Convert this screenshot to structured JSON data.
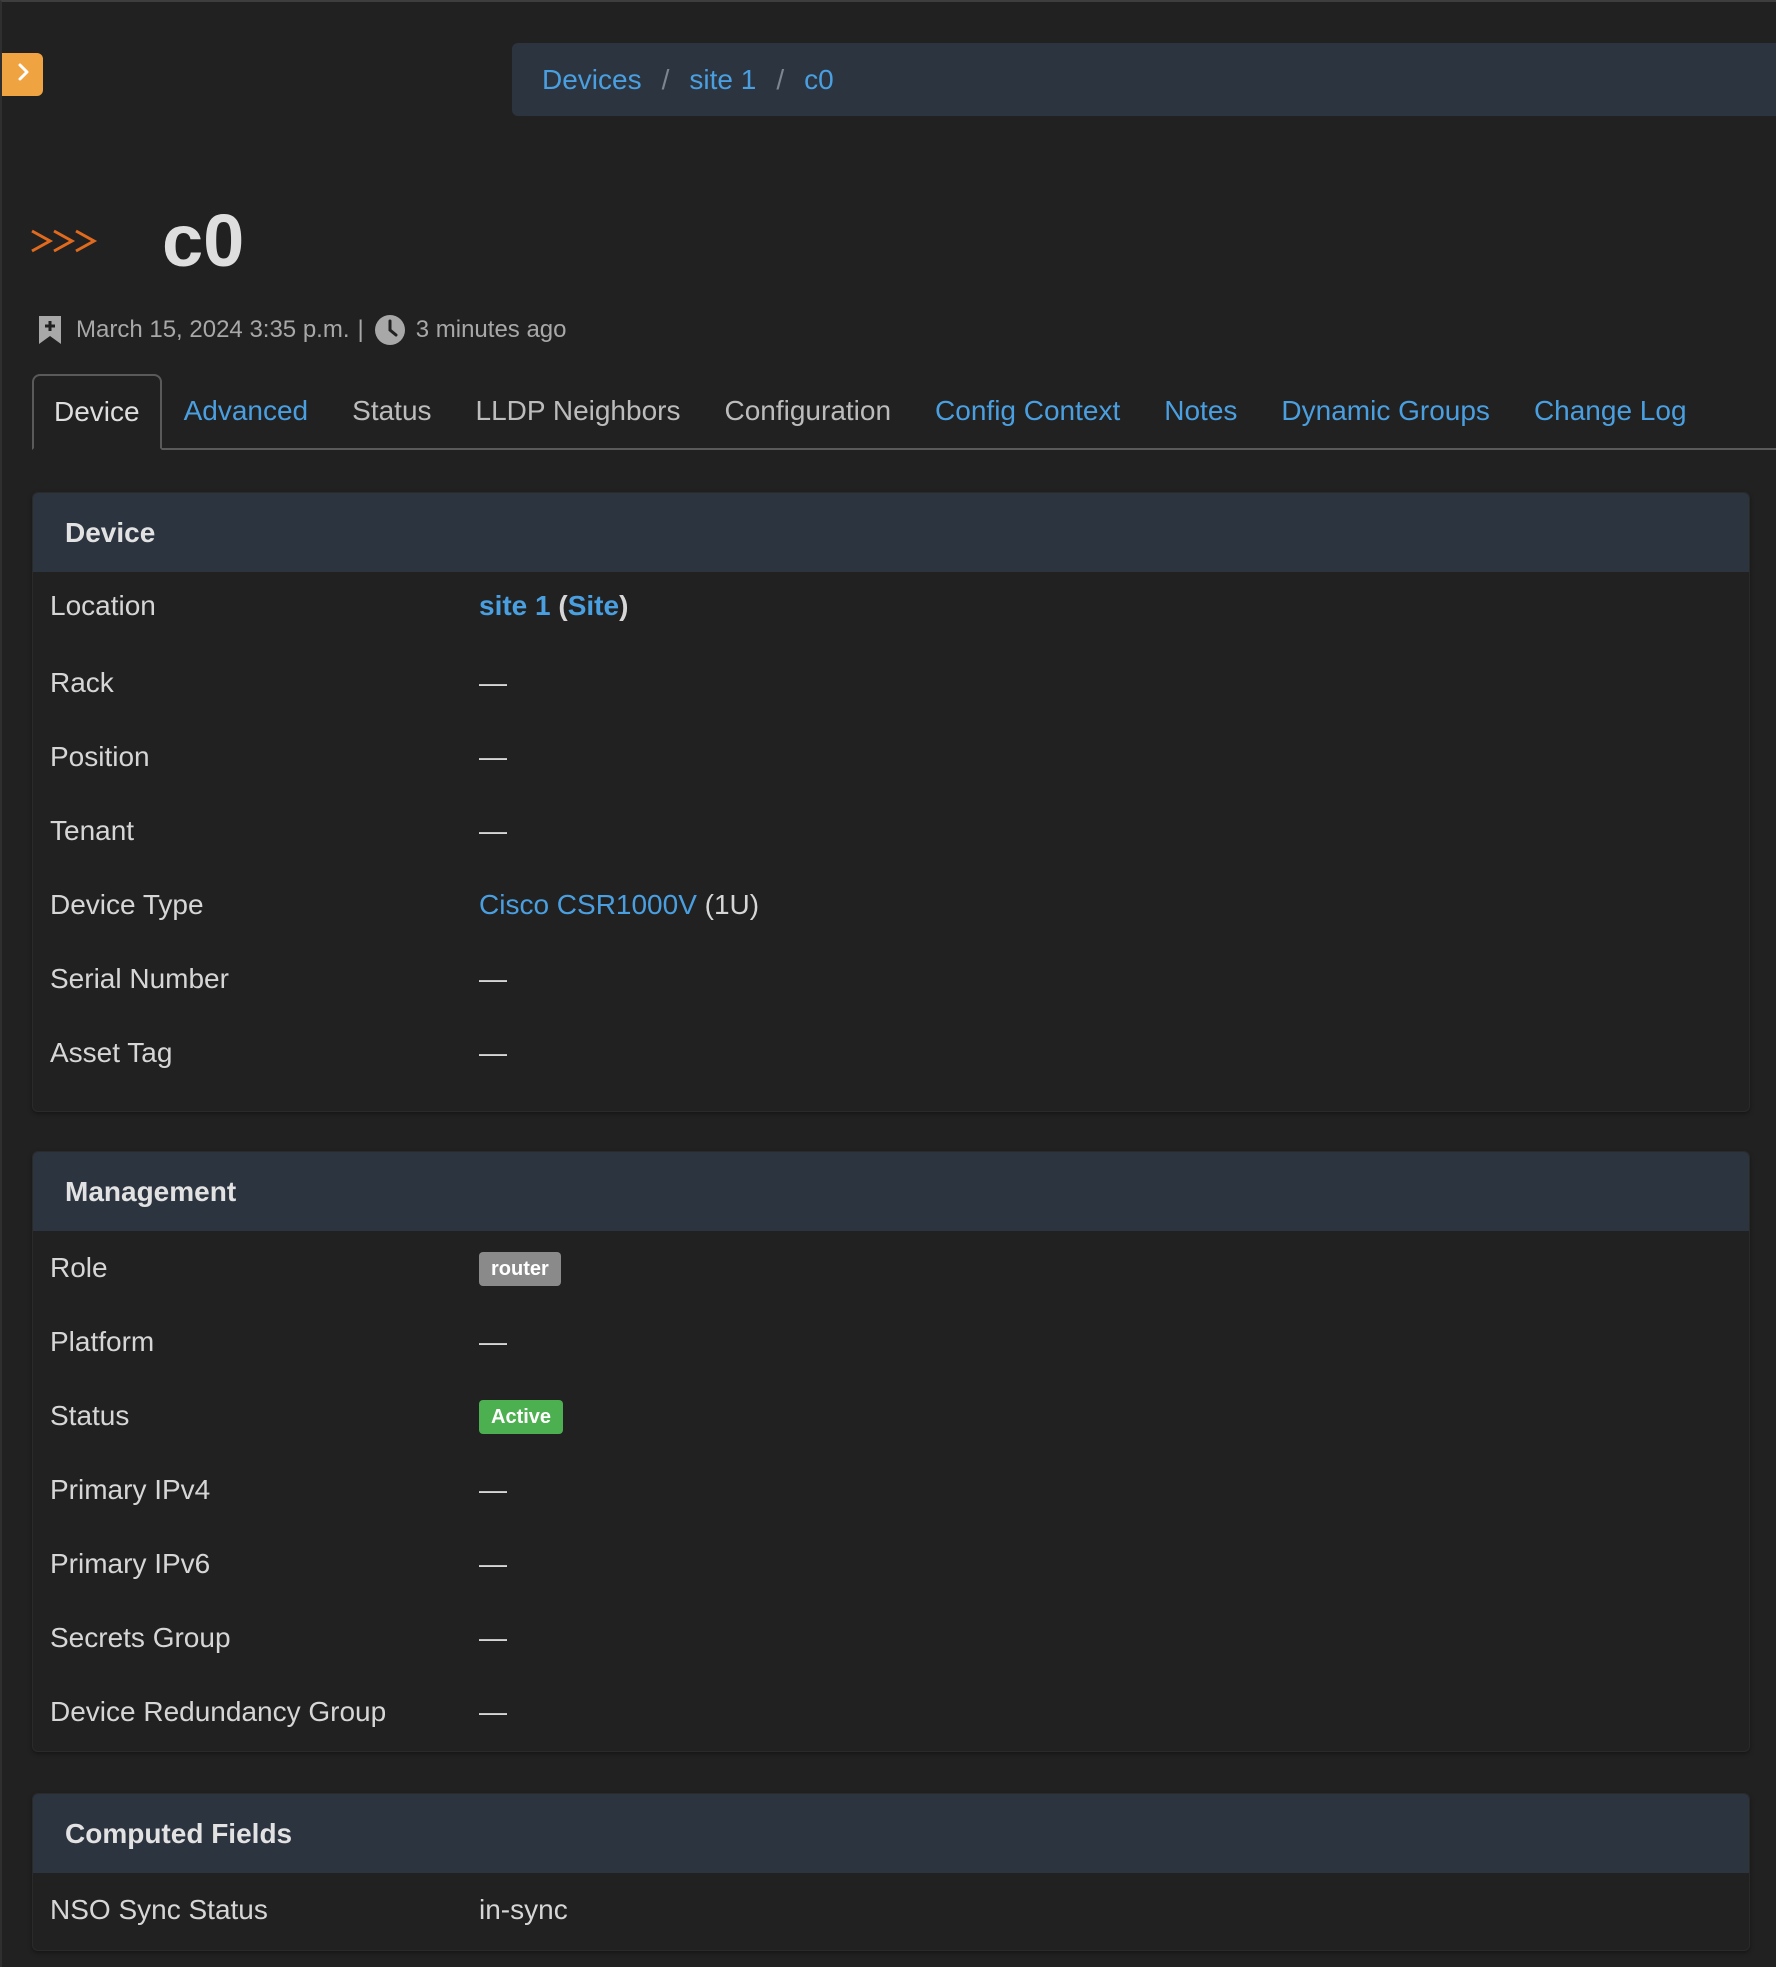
{
  "breadcrumb": [
    "Devices",
    "site 1",
    "c0"
  ],
  "breadcrumb_separator": "/",
  "title": "c0",
  "meta": {
    "created": "March 15, 2024 3:35 p.m.",
    "separator": "|",
    "updated": "3 minutes ago"
  },
  "tabs": [
    {
      "label": "Device",
      "state": "active"
    },
    {
      "label": "Advanced",
      "state": "link"
    },
    {
      "label": "Status",
      "state": "plain"
    },
    {
      "label": "LLDP Neighbors",
      "state": "plain"
    },
    {
      "label": "Configuration",
      "state": "plain"
    },
    {
      "label": "Config Context",
      "state": "link"
    },
    {
      "label": "Notes",
      "state": "link"
    },
    {
      "label": "Dynamic Groups",
      "state": "link"
    },
    {
      "label": "Change Log",
      "state": "link"
    }
  ],
  "device_panel": {
    "title": "Device",
    "location": {
      "label": "Location",
      "site": "site 1",
      "type": "Site",
      "open": "(",
      "close": ")"
    },
    "rack": {
      "label": "Rack",
      "value": "—"
    },
    "position": {
      "label": "Position",
      "value": "—"
    },
    "tenant": {
      "label": "Tenant",
      "value": "—"
    },
    "device_type": {
      "label": "Device Type",
      "link": "Cisco CSR1000V",
      "suffix": "(1U)"
    },
    "serial": {
      "label": "Serial Number",
      "value": "—"
    },
    "asset_tag": {
      "label": "Asset Tag",
      "value": "—"
    }
  },
  "management_panel": {
    "title": "Management",
    "role": {
      "label": "Role",
      "badge": "router"
    },
    "platform": {
      "label": "Platform",
      "value": "—"
    },
    "status": {
      "label": "Status",
      "badge": "Active"
    },
    "ipv4": {
      "label": "Primary IPv4",
      "value": "—"
    },
    "ipv6": {
      "label": "Primary IPv6",
      "value": "—"
    },
    "secrets": {
      "label": "Secrets Group",
      "value": "—"
    },
    "redundancy": {
      "label": "Device Redundancy Group",
      "value": "—"
    }
  },
  "computed_panel": {
    "title": "Computed Fields",
    "nso": {
      "label": "NSO Sync Status",
      "value": "in-sync"
    }
  },
  "colors": {
    "background": "#212121",
    "panel_header": "#2c3440",
    "link": "#4a9fe0",
    "toggle": "#f0a441",
    "chevrons": "#e06a1e",
    "status_active": "#4caf50",
    "role_badge": "#8a8a8a"
  },
  "icons": {
    "sidebar_toggle": "chevron-right-icon",
    "title": "chevrons-right-icon",
    "created": "bookmark-icon",
    "updated": "clock-icon"
  }
}
